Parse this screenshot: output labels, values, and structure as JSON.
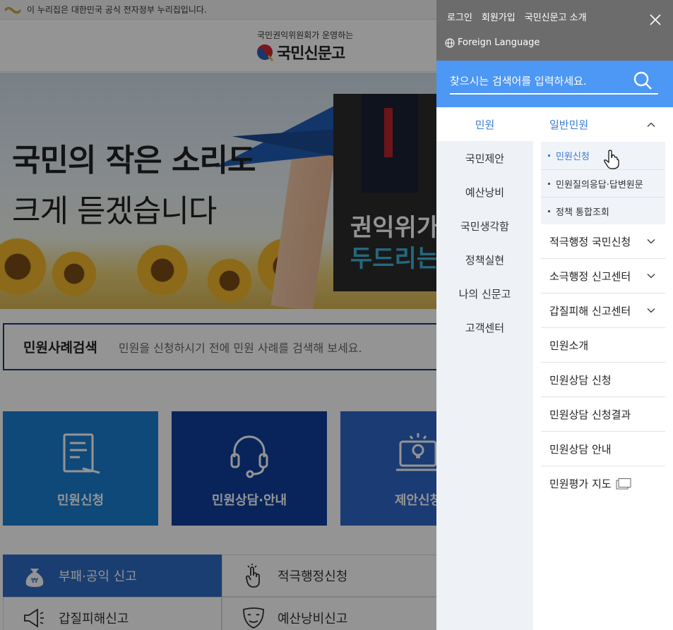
{
  "gov_banner": {
    "text": "이 누리집은 대한민국 공식 전자정부 누리집입니다."
  },
  "site": {
    "logo_sub": "국민권익위원회가 운영하는",
    "logo_main": "국민신문고"
  },
  "hero": {
    "line1": "국민의 작은 소리도",
    "line2": "크게 듣겠습니다",
    "video_line1": "권익위가",
    "video_line2": "두드리는"
  },
  "case_search": {
    "title": "민원사례검색",
    "description": "민원을 신청하시기 전에 민원 사례를 검색해 보세요."
  },
  "tiles": [
    {
      "label": "민원신청",
      "color": "#1a7fd0",
      "icon": "document-pen-icon"
    },
    {
      "label": "민원상담·안내",
      "color": "#0f3f9e",
      "icon": "headset-icon"
    },
    {
      "label": "제안신청",
      "color": "#2d66c8",
      "icon": "lightbulb-laptop-icon"
    }
  ],
  "services": [
    [
      {
        "label": "부패·공익 신고",
        "icon": "money-bag-icon"
      },
      {
        "label": "적극행정신청",
        "icon": "hand-click-icon"
      }
    ],
    [
      {
        "label": "갑질피해신고",
        "icon": "megaphone-icon"
      },
      {
        "label": "예산낭비신고",
        "icon": "mask-icon"
      }
    ]
  ],
  "drawer": {
    "top_links": [
      "로그인",
      "회원가입",
      "국민신문고 소개"
    ],
    "language": "Foreign Language",
    "search": {
      "placeholder": "찾으시는 검색어를 입력하세요."
    },
    "left_menu": [
      "민원",
      "국민제안",
      "예산낭비",
      "국민생각함",
      "정책실현",
      "나의 신문고",
      "고객센터"
    ],
    "left_active_index": 0,
    "right_menu": {
      "open": {
        "label": "일반민원",
        "sub": [
          "민원신청",
          "민원질의응답·답변원문",
          "정책 통합조회"
        ]
      },
      "items": [
        {
          "label": "적극행정 국민신청",
          "expandable": true
        },
        {
          "label": "소극행정 신고센터",
          "expandable": true
        },
        {
          "label": "갑질피해 신고센터",
          "expandable": true
        },
        {
          "label": "민원소개",
          "expandable": false
        },
        {
          "label": "민원상담 신청",
          "expandable": false
        },
        {
          "label": "민원상담 신청결과",
          "expandable": false
        },
        {
          "label": "민원상담 안내",
          "expandable": false
        },
        {
          "label": "민원평가 지도",
          "expandable": false,
          "new_window": true
        }
      ]
    }
  },
  "colors": {
    "accent": "#3a7bd5",
    "search_bar": "#4d97f5",
    "drawer_top": "#6c6c6c"
  }
}
